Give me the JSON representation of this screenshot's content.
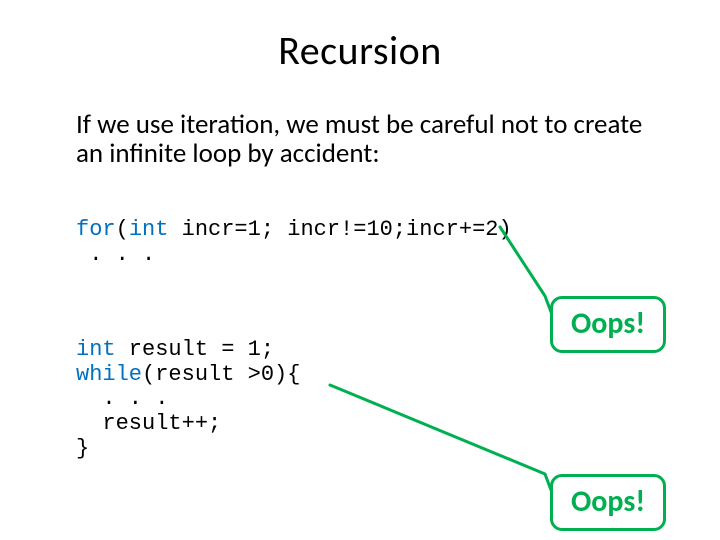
{
  "title": "Recursion",
  "body": "If we use iteration, we must be careful not to create an infinite loop by accident:",
  "code1": {
    "kw_for": "for",
    "seg1": "(",
    "kw_int": "int",
    "seg2": " incr=1; incr!=10;incr+=2)",
    "line2": " . . ."
  },
  "code2": {
    "kw_int": "int",
    "seg1": " result = 1;",
    "kw_while": "while",
    "seg2": "(result >0){",
    "line3": "  . . .",
    "line4": "  result++;",
    "line5": "}"
  },
  "callouts": {
    "oops1": "Oops!",
    "oops2": "Oops!"
  }
}
